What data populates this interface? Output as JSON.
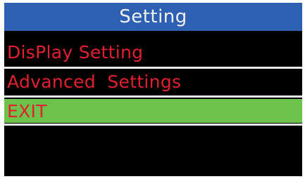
{
  "header": {
    "title": "Setting"
  },
  "menu": {
    "items": [
      {
        "label": "DisPlay Setting",
        "selected": false
      },
      {
        "label": "Advanced  Settings",
        "selected": false
      },
      {
        "label": "EXIT",
        "selected": true
      }
    ]
  },
  "colors": {
    "title_bar": "#2d5fb2",
    "title_text": "#f2f2f2",
    "screen_background": "#000000",
    "item_text": "#e3202f",
    "selected_highlight": "#6cc24a",
    "divider": "#e8e8e8"
  }
}
